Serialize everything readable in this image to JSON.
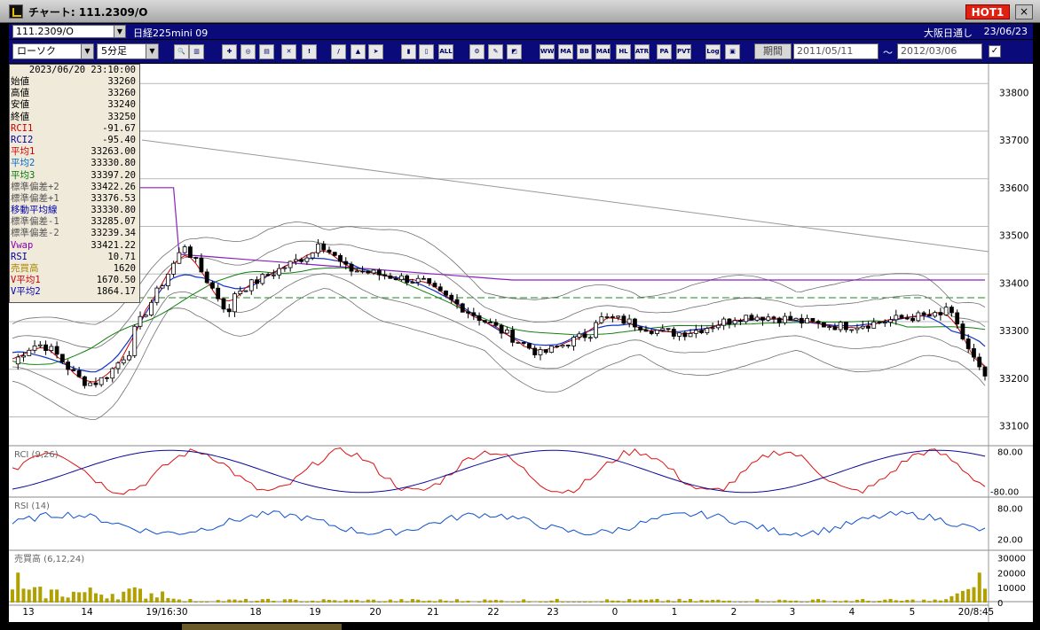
{
  "window": {
    "title": "チャート: 111.2309/O",
    "hot_label": "HOT1",
    "close_label": "×"
  },
  "symbolbar": {
    "code": "111.2309/O",
    "name": "日経225mini 09",
    "exchange": "大阪日通し",
    "date": "23/06/23"
  },
  "toolbar": {
    "chart_type": "ローソク",
    "interval": "5分足",
    "buttons": [
      {
        "name": "zoom-button",
        "glyph": "🔍"
      },
      {
        "name": "bars-button",
        "glyph": "▥"
      },
      {
        "name": "tool-a-button",
        "glyph": "✚"
      },
      {
        "name": "tool-b-button",
        "glyph": "◎"
      },
      {
        "name": "tool-c-button",
        "glyph": "▤"
      },
      {
        "name": "tool-d-button",
        "glyph": "✕"
      },
      {
        "name": "tool-e-button",
        "glyph": "!"
      },
      {
        "name": "line-tool-button",
        "glyph": "/"
      },
      {
        "name": "pointer-button",
        "glyph": "▲"
      },
      {
        "name": "arrow-tool-button",
        "glyph": "➤"
      },
      {
        "name": "candle-a-button",
        "glyph": "▮"
      },
      {
        "name": "candle-b-button",
        "glyph": "▯"
      },
      {
        "name": "all-button",
        "glyph": "ALL"
      },
      {
        "name": "settings-button",
        "glyph": "⚙"
      },
      {
        "name": "edit-button",
        "glyph": "✎"
      },
      {
        "name": "color-button",
        "glyph": "◩"
      },
      {
        "name": "indicator-button",
        "glyph": "WW"
      },
      {
        "name": "ma-button",
        "glyph": "MA"
      },
      {
        "name": "bb-button",
        "glyph": "BB"
      },
      {
        "name": "mae-button",
        "glyph": "MAE"
      },
      {
        "name": "hl-button",
        "glyph": "HL"
      },
      {
        "name": "atr-button",
        "glyph": "ATR"
      },
      {
        "name": "para-button",
        "glyph": "PA"
      },
      {
        "name": "pvt-button",
        "glyph": "PVT"
      },
      {
        "name": "log-button",
        "glyph": "Log"
      },
      {
        "name": "export-button",
        "glyph": "▣"
      }
    ],
    "period_label": "期間",
    "date_from": "2011/05/11",
    "date_to": "2012/03/06",
    "tilde": "〜",
    "check": "✓"
  },
  "info": {
    "datetime": "2023/06/20 23:10:00",
    "rows": [
      {
        "label": "始値",
        "value": "33260",
        "color": "#000000"
      },
      {
        "label": "高値",
        "value": "33260",
        "color": "#000000"
      },
      {
        "label": "安値",
        "value": "33240",
        "color": "#000000"
      },
      {
        "label": "終値",
        "value": "33250",
        "color": "#000000"
      },
      {
        "label": "RCI1",
        "value": "-91.67",
        "color": "#cc0000"
      },
      {
        "label": "RCI2",
        "value": "-95.40",
        "color": "#0000aa"
      },
      {
        "label": "平均1",
        "value": "33263.00",
        "color": "#cc0000"
      },
      {
        "label": "平均2",
        "value": "33330.80",
        "color": "#0066cc"
      },
      {
        "label": "平均3",
        "value": "33397.20",
        "color": "#007700"
      },
      {
        "label": "標準偏差+2",
        "value": "33422.26",
        "color": "#555555"
      },
      {
        "label": "標準偏差+1",
        "value": "33376.53",
        "color": "#555555"
      },
      {
        "label": "移動平均線",
        "value": "33330.80",
        "color": "#0000aa"
      },
      {
        "label": "標準偏差-1",
        "value": "33285.07",
        "color": "#555555"
      },
      {
        "label": "標準偏差-2",
        "value": "33239.34",
        "color": "#555555"
      },
      {
        "label": "Vwap",
        "value": "33421.22",
        "color": "#8800aa"
      },
      {
        "label": "RSI",
        "value": "10.71",
        "color": "#0000aa"
      },
      {
        "label": "売買高",
        "value": "1620",
        "color": "#aa8800"
      },
      {
        "label": "V平均1",
        "value": "1670.50",
        "color": "#cc0000"
      },
      {
        "label": "V平均2",
        "value": "1864.17",
        "color": "#0000aa"
      }
    ]
  },
  "chart_data": {
    "type": "candlestick",
    "price_axis": {
      "ticks": [
        "33800",
        "33700",
        "33600",
        "33500",
        "33400",
        "33300",
        "33200",
        "33100"
      ],
      "range": [
        33060,
        33860
      ]
    },
    "x_labels": [
      "13",
      "14",
      "19/16:30",
      "18",
      "19",
      "20",
      "21",
      "22",
      "23",
      "0",
      "1",
      "2",
      "3",
      "4",
      "5",
      "20/8:45"
    ],
    "rci_panel": {
      "label": "RCI (9,26)",
      "ticks": [
        "80.00",
        "-80.00"
      ]
    },
    "rsi_panel": {
      "label": "RSI (14)",
      "ticks": [
        "80.00",
        "20.00"
      ]
    },
    "volume_panel": {
      "label": "売買高 (6,12,24)",
      "ticks": [
        "30000",
        "20000",
        "10000",
        "0"
      ]
    },
    "colors": {
      "ma1": "#cc0000",
      "ma2": "#1030cc",
      "ma3": "#108010",
      "vwap": "#8a20c0",
      "band": "#707070",
      "rci1": "#dd1010",
      "rci2": "#0a0a9a",
      "rsi": "#1050cc",
      "volume": "#b0a000"
    }
  }
}
